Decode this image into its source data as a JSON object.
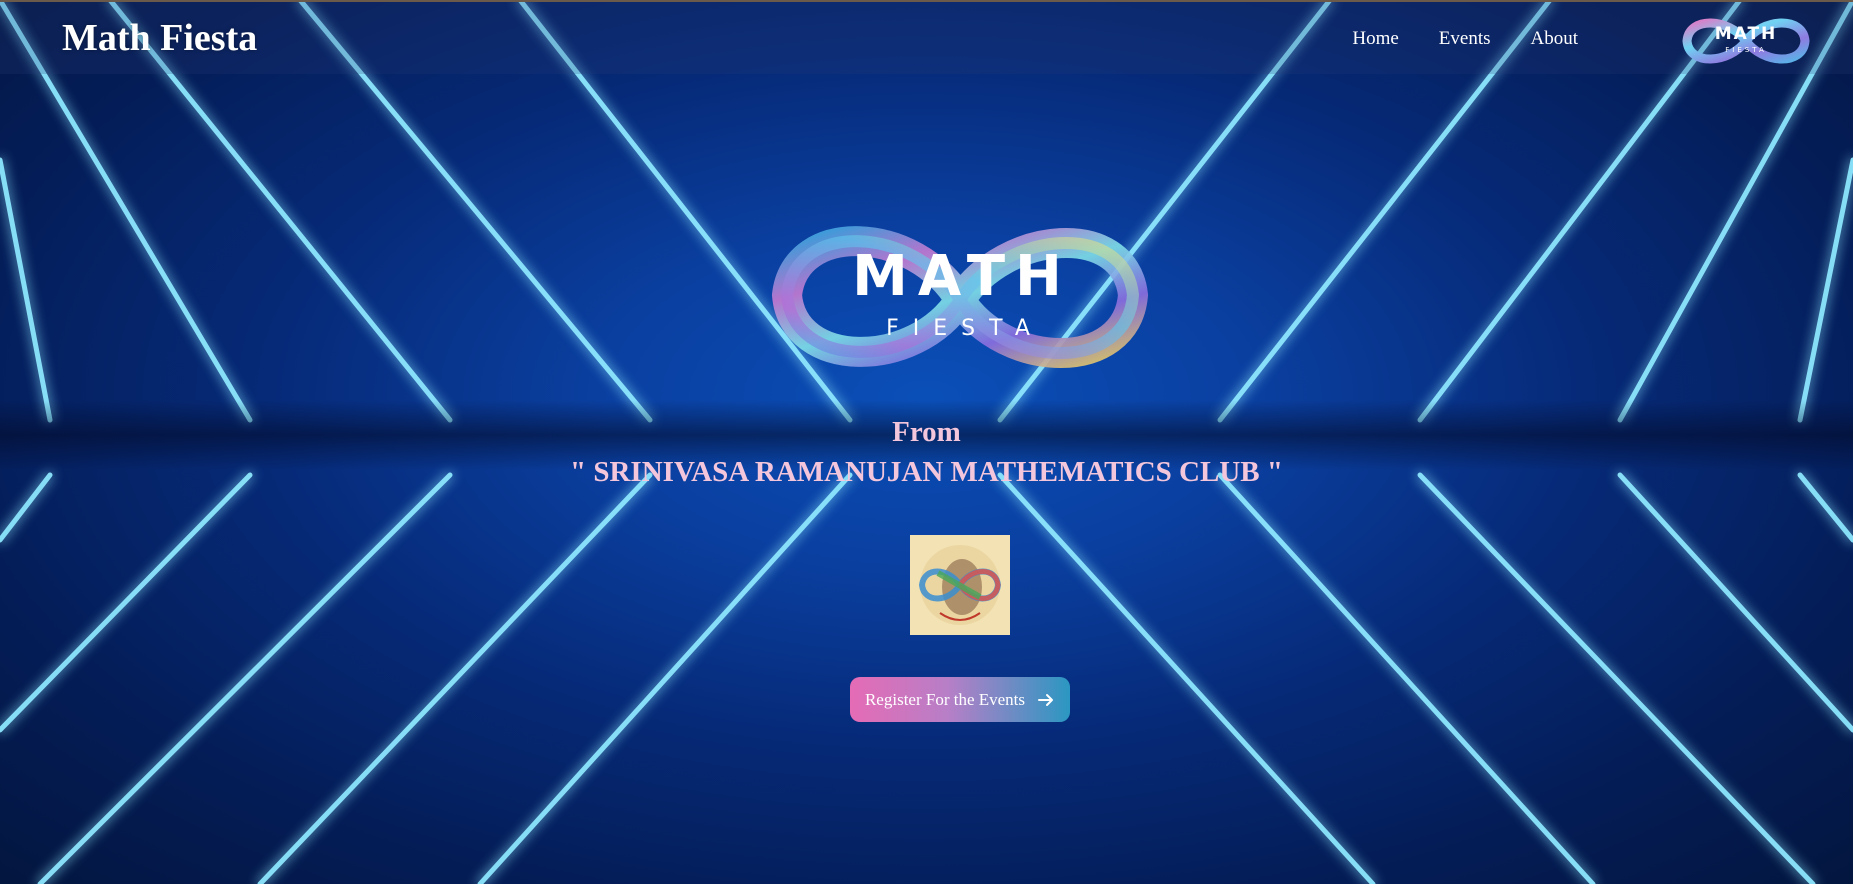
{
  "navbar": {
    "brand": "Math Fiesta",
    "links": [
      "Home",
      "Events",
      "About"
    ],
    "logo_icon": "math-fiesta-infinity-logo"
  },
  "hero": {
    "logo_icon": "math-fiesta-infinity-logo",
    "logo_word": "MATH",
    "logo_sub": "FIESTA",
    "from_label": "From",
    "club_name": "\" SRINIVASA RAMANUJAN MATHEMATICS CLUB \"",
    "club_logo_icon": "ramanujan-club-emblem",
    "register_label": "Register For the Events",
    "register_icon": "arrow-right-icon"
  },
  "colors": {
    "background": "#0a3fa0",
    "neon": "#7fe3ff",
    "heading_pink": "#f3c6dc",
    "button_start": "#e56bb5",
    "button_end": "#2b97c2"
  }
}
